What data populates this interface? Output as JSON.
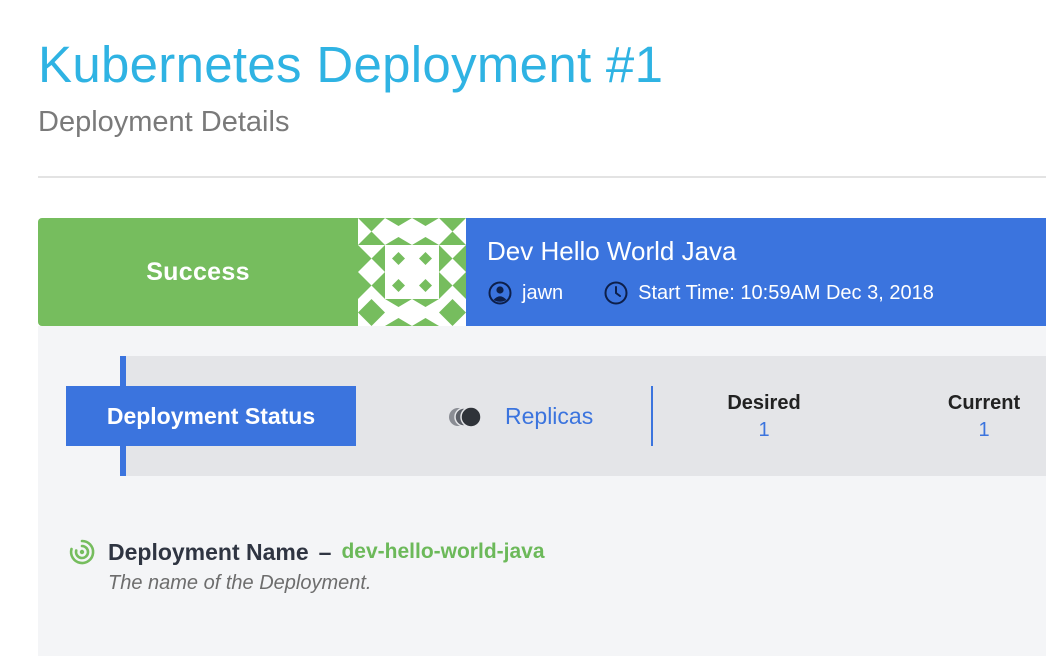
{
  "header": {
    "title": "Kubernetes Deployment #1",
    "subtitle": "Deployment Details"
  },
  "banner": {
    "status": "Success",
    "status_color": "#76bd5e",
    "accent_color": "#3b74de",
    "name": "Dev Hello World Java",
    "user_icon": "user-circle-icon",
    "user": "jawn",
    "time_icon": "clock-icon",
    "start_time": "Start Time: 10:59AM Dec 3, 2018"
  },
  "status_section": {
    "tab_label": "Deployment Status",
    "replicas_icon": "replicas-icon",
    "replicas_label": "Replicas",
    "stats": [
      {
        "label": "Desired",
        "value": "1"
      },
      {
        "label": "Current",
        "value": "1"
      }
    ]
  },
  "fields": [
    {
      "icon": "spiral-target-icon",
      "name": "Deployment Name",
      "separator": "–",
      "value": "dev-hello-world-java",
      "description": "The name of the Deployment."
    }
  ]
}
